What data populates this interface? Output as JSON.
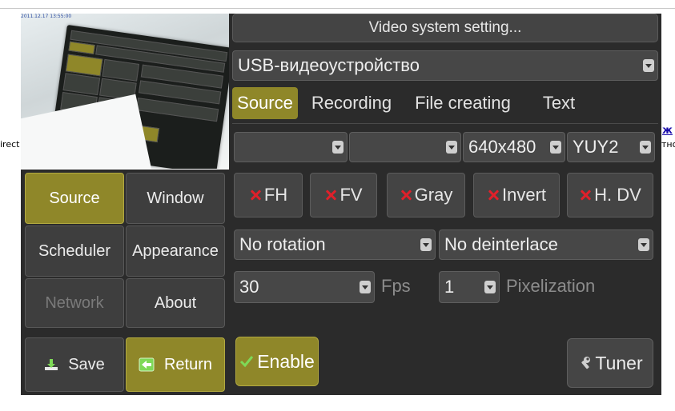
{
  "page_edge": {
    "left_fragment": "irect",
    "right_link": "ж",
    "right_fragment": "тно"
  },
  "preview": {
    "timestamp": "2011.12.17 13:55:00"
  },
  "left_menu": {
    "source": "Source",
    "window": "Window",
    "scheduler": "Scheduler",
    "appearance": "Appearance",
    "network": "Network",
    "about": "About",
    "save": "Save",
    "return": "Return"
  },
  "settings": {
    "title": "Video system setting...",
    "device": "USB-видеоустройство",
    "tabs": [
      "Source",
      "Recording",
      "File creating",
      "Text"
    ],
    "active_tab": "Source",
    "format_row": {
      "combo1": "",
      "combo2": "",
      "resolution": "640x480",
      "pixel_format": "YUY2"
    },
    "toggles": [
      "FH",
      "FV",
      "Gray",
      "Invert",
      "H. DV"
    ],
    "rotation": "No rotation",
    "deinterlace": "No deinterlace",
    "fps_value": "30",
    "fps_label": "Fps",
    "pixelization_value": "1",
    "pixelization_label": "Pixelization",
    "enable_label": "Enable",
    "tuner_label": "Tuner"
  },
  "colors": {
    "accent": "#8f8729",
    "panel": "#2b2b2b",
    "button": "#3e3e3e",
    "disabled_text": "#7a7a7a",
    "x_mark": "#e0202a",
    "check": "#7ed957"
  },
  "icons": {
    "toggle_state": "x-mark-icon",
    "save": "download-icon",
    "return": "return-arrow-icon",
    "enable": "checkmark-icon",
    "tuner": "wrench-icon",
    "combo": "chevron-down-icon"
  }
}
